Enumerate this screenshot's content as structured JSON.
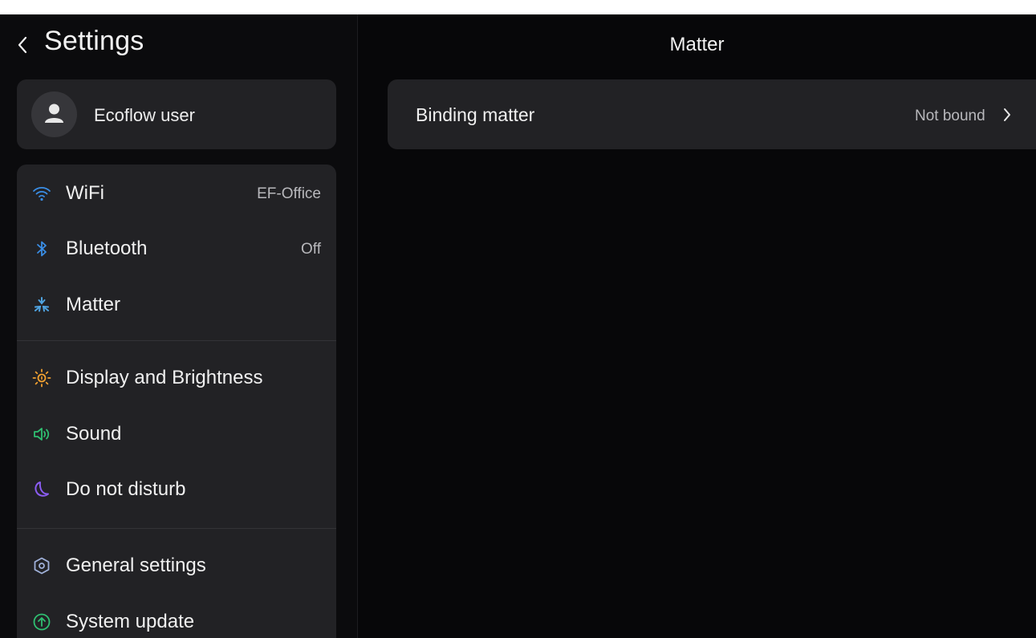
{
  "header": {
    "back_icon": "chevron-left-icon",
    "title": "Settings"
  },
  "user": {
    "name": "Ecoflow user",
    "avatar_icon": "user-avatar-icon"
  },
  "menu": {
    "items": [
      {
        "id": "wifi",
        "label": "WiFi",
        "value": "EF-Office",
        "icon": "wifi-icon",
        "color": "#3a8ee6"
      },
      {
        "id": "bluetooth",
        "label": "Bluetooth",
        "value": "Off",
        "icon": "bluetooth-icon",
        "color": "#3a8ee6"
      },
      {
        "id": "matter",
        "label": "Matter",
        "value": "",
        "icon": "matter-icon",
        "color": "#4fa3e0"
      },
      {
        "id": "display",
        "label": "Display and Brightness",
        "value": "",
        "icon": "sun-icon",
        "color": "#f0a030"
      },
      {
        "id": "sound",
        "label": "Sound",
        "value": "",
        "icon": "speaker-icon",
        "color": "#2fbf71"
      },
      {
        "id": "dnd",
        "label": "Do not disturb",
        "value": "",
        "icon": "moon-icon",
        "color": "#8a5cf0"
      },
      {
        "id": "general",
        "label": "General settings",
        "value": "",
        "icon": "gear-hex-icon",
        "color": "#9fb0d8"
      },
      {
        "id": "update",
        "label": "System update",
        "value": "",
        "icon": "update-arrow-icon",
        "color": "#2fbf71"
      }
    ]
  },
  "main": {
    "title": "Matter",
    "binding": {
      "label": "Binding matter",
      "status": "Not bound",
      "chevron_icon": "chevron-right-icon"
    }
  },
  "colors": {
    "background": "#070709",
    "card": "#222225",
    "text_primary": "#f0f0f0",
    "text_secondary": "#b8b8bc"
  }
}
